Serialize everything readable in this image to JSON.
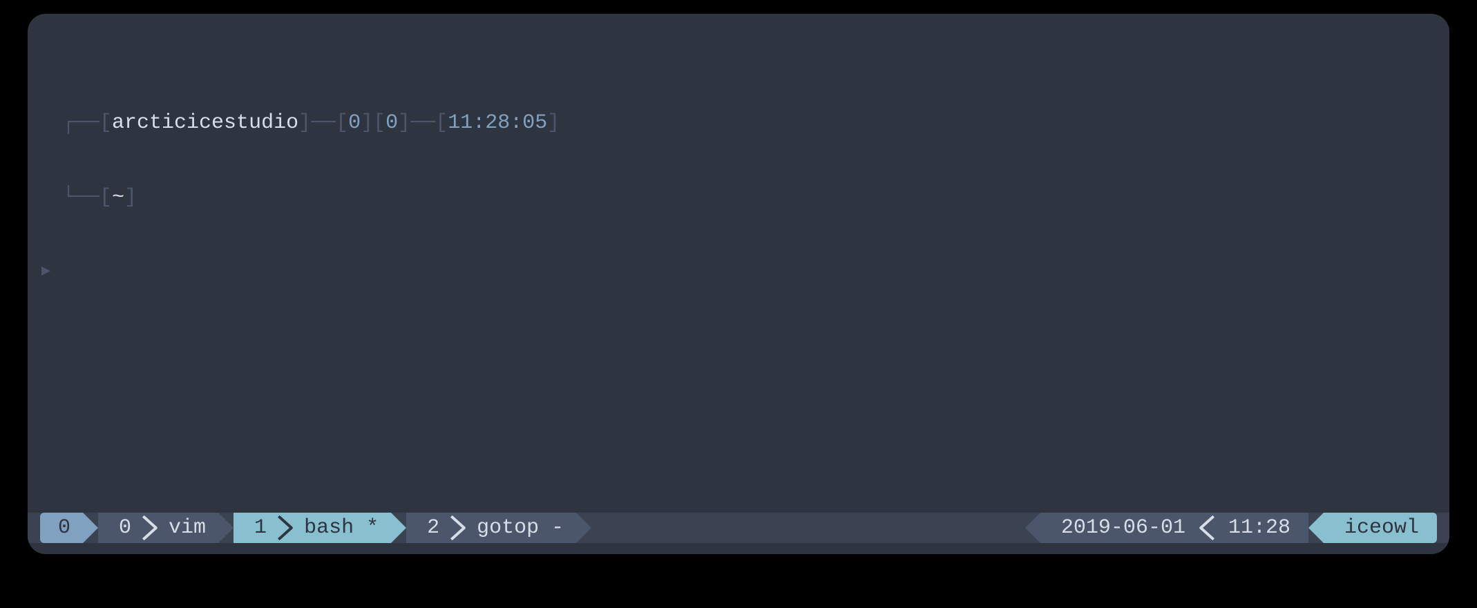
{
  "prompt": {
    "user": "arcticicestudio",
    "exit_code": "0",
    "jobs": "0",
    "time": "11:28:05",
    "cwd": "~",
    "prompt_char": "▶"
  },
  "tmux": {
    "session": "0",
    "windows": [
      {
        "index": "0",
        "name": "vim",
        "flag": "",
        "current": false
      },
      {
        "index": "1",
        "name": "bash",
        "flag": "*",
        "current": true
      },
      {
        "index": "2",
        "name": "gotop",
        "flag": "-",
        "current": false
      }
    ],
    "date": "2019-06-01",
    "clock": "11:28",
    "host": "iceowl"
  }
}
